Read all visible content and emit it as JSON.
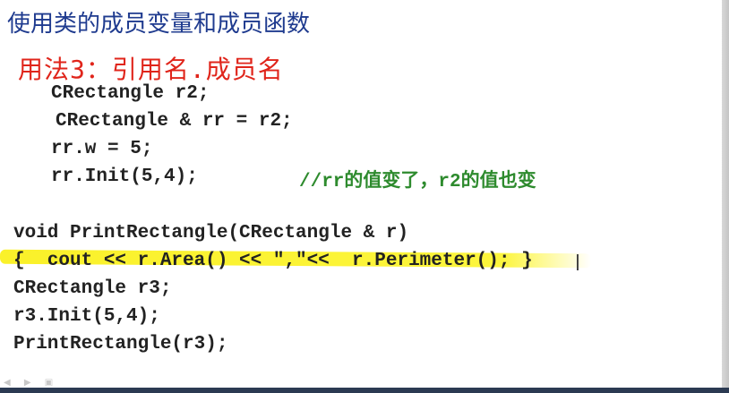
{
  "slide": {
    "title": "使用类的成员变量和成员函数",
    "usage_heading": "用法3：引用名.成员名"
  },
  "code_lines": [
    "CRectangle r2;",
    "CRectangle & rr = r2;",
    "rr.w = 5;",
    "rr.Init(5,4);",
    "void PrintRectangle(CRectangle & r)",
    "{  cout << r.Area() << \",\"<<  r.Perimeter(); }",
    "CRectangle r3;",
    "r3.Init(5,4);",
    "PrintRectangle(r3);"
  ],
  "comment": "//rr的值变了，r2的值也变",
  "colors": {
    "title": "#1f3b8f",
    "heading": "#e0251b",
    "comment": "#2e8b2e",
    "highlight": "#faf01e"
  },
  "icons": [
    "slide-nav-arrows-icon",
    "text-cursor-icon"
  ]
}
